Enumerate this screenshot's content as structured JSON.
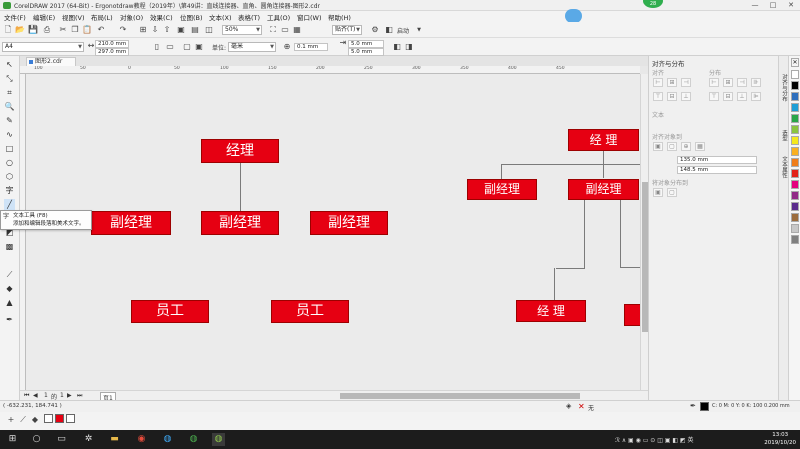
{
  "window": {
    "title": "CorelDRAW 2017 (64-Bit) - Ergonotdraw教程（2019年）\\第49讲：直线连接器、直角、圆角连接器-图形2.cdr",
    "badge": "28",
    "controls": [
      "—",
      "□",
      "✕"
    ]
  },
  "menu": [
    "文件(F)",
    "编辑(E)",
    "视图(V)",
    "布局(L)",
    "对象(O)",
    "效果(C)",
    "位图(B)",
    "文本(X)",
    "表格(T)",
    "工具(O)",
    "窗口(W)",
    "帮助(H)"
  ],
  "toolbar": {
    "zoom": "50%",
    "snap_label": "贴齐(T)",
    "auto_label": "启动"
  },
  "propbar": {
    "page_size": "A4",
    "width": "210.0 mm",
    "height": "297.0 mm",
    "units_label": "单位:",
    "units": "毫米",
    "nudge": "0.1 mm",
    "dup_x": "5.0 mm",
    "dup_y": "5.0 mm"
  },
  "document": {
    "tab_label": "图形2.cdr"
  },
  "ruler_ticks": [
    "100",
    "50",
    "0",
    "50",
    "100",
    "150",
    "200",
    "250",
    "300",
    "350",
    "400",
    "450"
  ],
  "tooltip": {
    "title": "文本工具 (F8)",
    "desc": "添加和编辑段落和美术文字。"
  },
  "canvas": {
    "boxes": {
      "manager_a": "经理",
      "deputy_a1": "副经理",
      "deputy_a2": "副经理",
      "deputy_a3": "副经理",
      "staff_1": "员工",
      "staff_2": "员工",
      "manager_b": "经 理",
      "deputy_b1": "副经理",
      "deputy_b2": "副经理",
      "manager_c": "经 理"
    },
    "box_color": "#e60012"
  },
  "pagenav": {
    "current": "1",
    "of": "的",
    "total": "1",
    "page_tab": "页1"
  },
  "docker": {
    "title": "对齐与分布",
    "section_align": "对齐",
    "section_distribute": "分布",
    "section_text": "文本",
    "section_objects": "对齐对象到",
    "x_value": "135.0 mm",
    "y_value": "148.5 mm",
    "section_distribute_to": "将对象分布到",
    "side_tabs": [
      "对齐与分布",
      "造型",
      "文本属性"
    ]
  },
  "palette_colors": [
    "#ffffff",
    "#000000",
    "#2e6fbd",
    "#1f9fd6",
    "#2aa649",
    "#8cc540",
    "#f5e81d",
    "#f9b021",
    "#ef7d1a",
    "#e2231a",
    "#e5007e",
    "#922b87",
    "#5a2b8c",
    "#9c6d3e",
    "#c8c8c8",
    "#808080"
  ],
  "status": {
    "coords": "( -632.231, 184.741 )",
    "fill_none": "无",
    "fill_info": "C: 0 M: 0 Y: 0 K: 100 0.200 mm"
  },
  "taskbar": {
    "time": "13:03",
    "date": "2019/10/20"
  }
}
